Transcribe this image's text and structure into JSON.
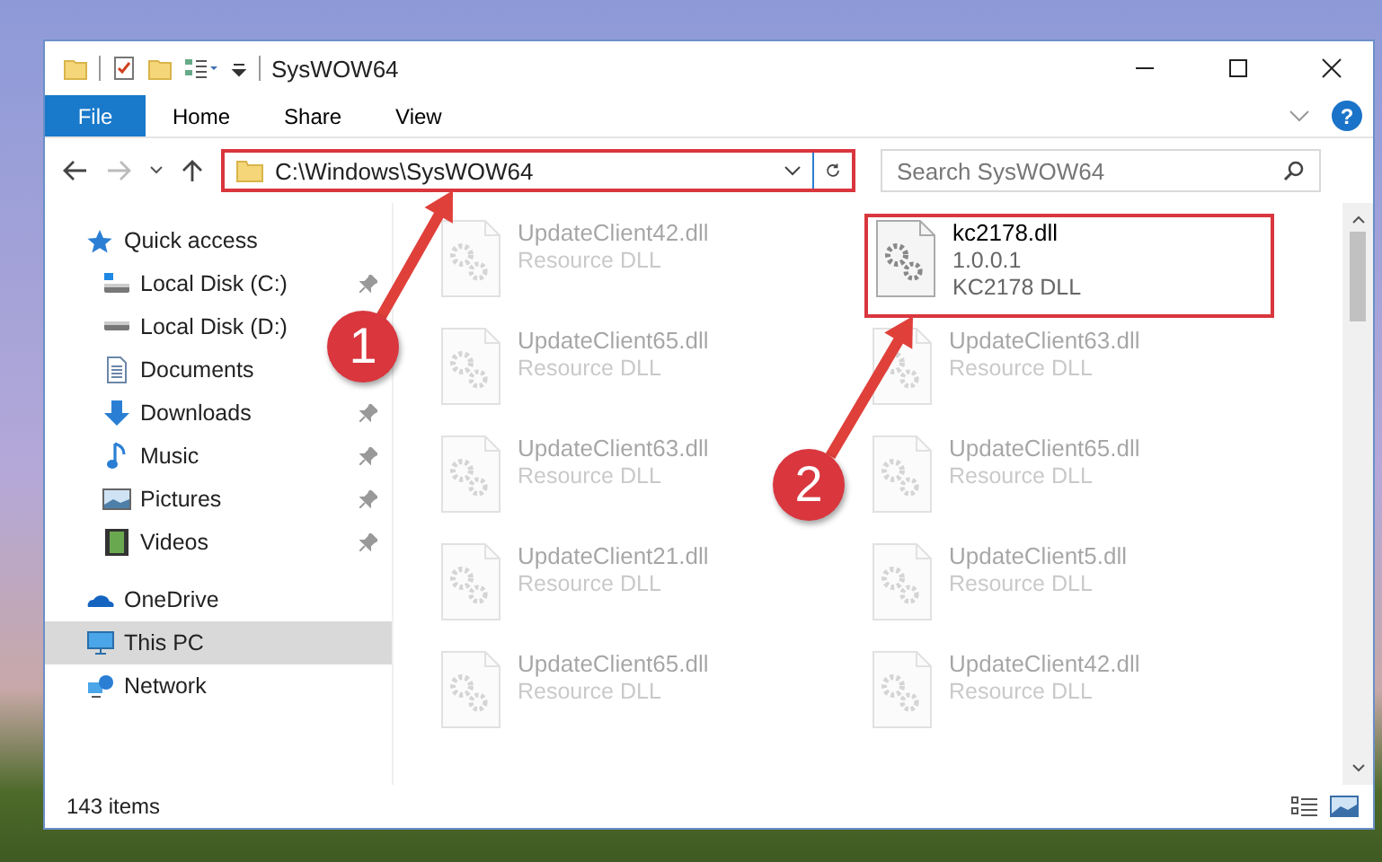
{
  "window": {
    "title": "SysWOW64"
  },
  "ribbon": {
    "help": "?",
    "tabs": [
      {
        "label": "File",
        "kind": "file"
      },
      {
        "label": "Home",
        "kind": "tab"
      },
      {
        "label": "Share",
        "kind": "tab"
      },
      {
        "label": "View",
        "kind": "tab"
      }
    ]
  },
  "address_bar": {
    "path": "C:\\Windows\\SysWOW64",
    "highlighted": true
  },
  "search": {
    "placeholder": "Search SysWOW64"
  },
  "sidebar": {
    "items": [
      {
        "label": "Quick access",
        "selected": false,
        "children": [
          {
            "label": "Local Disk (C:)",
            "pinned": true,
            "selected": false
          },
          {
            "label": "Local Disk (D:)",
            "selected": false
          },
          {
            "label": "Documents",
            "selected": false
          },
          {
            "label": "Downloads",
            "pinned": true,
            "selected": false
          },
          {
            "label": "Music",
            "pinned": true,
            "selected": false
          },
          {
            "label": "Pictures",
            "pinned": true,
            "selected": false
          },
          {
            "label": "Videos",
            "pinned": true,
            "selected": false
          }
        ]
      },
      {
        "label": "OneDrive",
        "selected": false
      },
      {
        "label": "This PC",
        "selected": true
      },
      {
        "label": "Network",
        "selected": false
      }
    ]
  },
  "files": [
    {
      "name": "UpdateClient42.dll",
      "lines": [
        "Resource DLL"
      ],
      "highlighted": false
    },
    {
      "name": "kc2178.dll",
      "lines": [
        "1.0.0.1",
        "KC2178 DLL"
      ],
      "highlighted": true
    },
    {
      "name": "UpdateClient65.dll",
      "lines": [
        "Resource DLL"
      ],
      "highlighted": false
    },
    {
      "name": "UpdateClient63.dll",
      "lines": [
        "Resource DLL"
      ],
      "highlighted": false
    },
    {
      "name": "UpdateClient63.dll",
      "lines": [
        "Resource DLL"
      ],
      "highlighted": false
    },
    {
      "name": "UpdateClient65.dll",
      "lines": [
        "Resource DLL"
      ],
      "highlighted": false
    },
    {
      "name": "UpdateClient21.dll",
      "lines": [
        "Resource DLL"
      ],
      "highlighted": false
    },
    {
      "name": "UpdateClient5.dll",
      "lines": [
        "Resource DLL"
      ],
      "highlighted": false
    },
    {
      "name": "UpdateClient65.dll",
      "lines": [
        "Resource DLL"
      ],
      "highlighted": false
    },
    {
      "name": "UpdateClient42.dll",
      "lines": [
        "Resource DLL"
      ],
      "highlighted": false
    }
  ],
  "status_bar": {
    "item_count": "143 items"
  },
  "annotations": [
    {
      "label": "1"
    },
    {
      "label": "2"
    }
  ]
}
